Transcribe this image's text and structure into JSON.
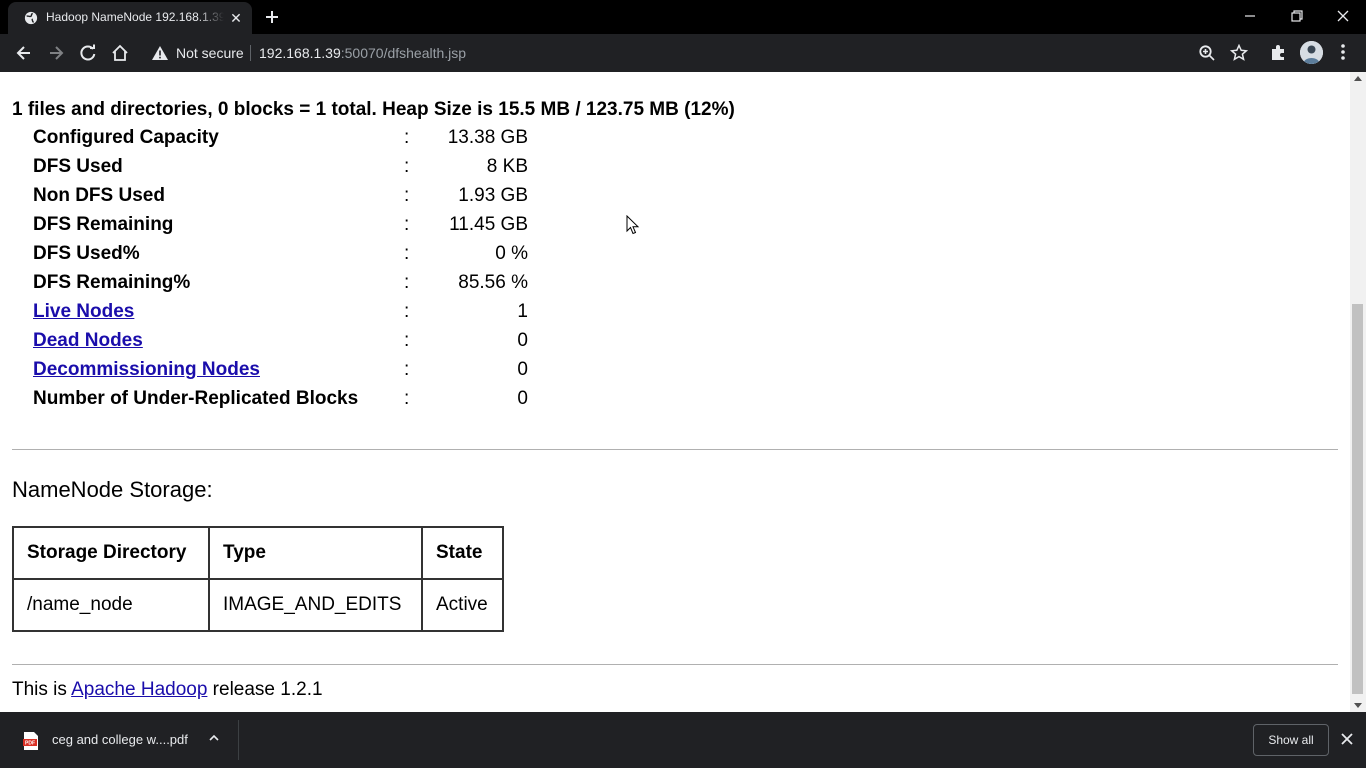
{
  "browser": {
    "tab_title": "Hadoop NameNode 192.168.1.39:50070",
    "tab_close": "✕",
    "security_label": "Not secure",
    "url_host": "192.168.1.39",
    "url_rest": ":50070/dfshealth.jsp"
  },
  "page": {
    "summary": "1 files and directories, 0 blocks = 1 total. Heap Size is 15.5 MB / 123.75 MB (12%)",
    "colon": ":",
    "stats": [
      {
        "label": "Configured Capacity",
        "value": "13.38 GB",
        "link": false
      },
      {
        "label": "DFS Used",
        "value": "8 KB",
        "link": false
      },
      {
        "label": "Non DFS Used",
        "value": "1.93 GB",
        "link": false
      },
      {
        "label": "DFS Remaining",
        "value": "11.45 GB",
        "link": false
      },
      {
        "label": "DFS Used%",
        "value": "0 %",
        "link": false
      },
      {
        "label": "DFS Remaining%",
        "value": "85.56 %",
        "link": false
      },
      {
        "label": "Live Nodes",
        "value": "1",
        "link": true
      },
      {
        "label": "Dead Nodes",
        "value": "0",
        "link": true
      },
      {
        "label": "Decommissioning Nodes",
        "value": "0",
        "link": true
      },
      {
        "label": "Number of Under-Replicated Blocks",
        "value": "0",
        "link": false
      }
    ],
    "storage": {
      "title": "NameNode Storage:",
      "headers": [
        "Storage Directory",
        "Type",
        "State"
      ],
      "rows": [
        [
          "/name_node",
          "IMAGE_AND_EDITS",
          "Active"
        ]
      ]
    },
    "footer": {
      "prefix": "This is ",
      "link": "Apache Hadoop",
      "suffix": " release 1.2.1"
    }
  },
  "downloads": {
    "file_name": "ceg and college w....pdf",
    "show_all": "Show all"
  },
  "colors": {
    "chrome_dark": "#202124",
    "link": "#1a0dab"
  }
}
